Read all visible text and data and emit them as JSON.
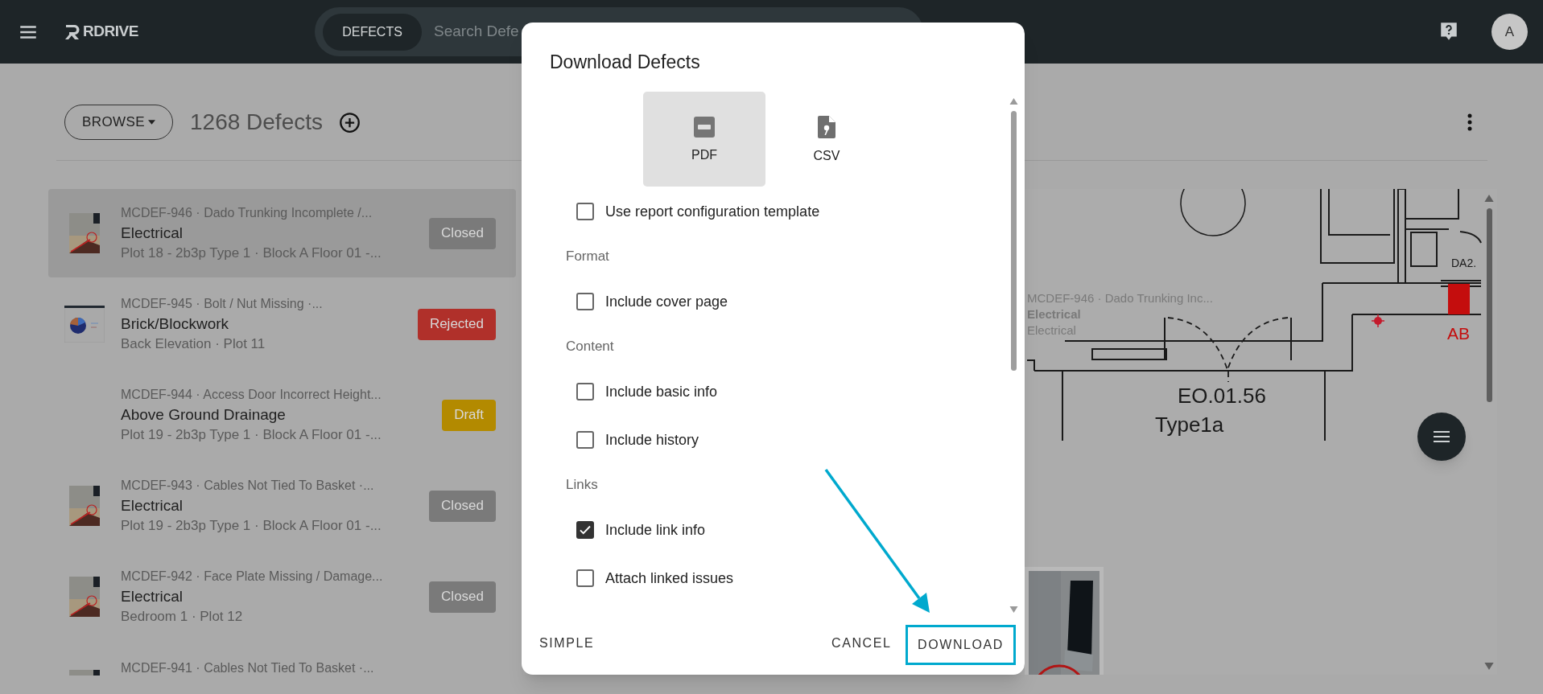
{
  "top_bar": {
    "logo": "RDRIVE",
    "search": {
      "scope": "DEFECTS",
      "placeholder": "Search Defe"
    },
    "avatar": "A"
  },
  "list_header": {
    "browse": "BROWSE",
    "count": "1268 Defects"
  },
  "defects": [
    {
      "selected": true,
      "thumbnail": true,
      "title": "MCDEF-946 · Dado Trunking Incomplete /...",
      "category": "Electrical",
      "location": "Plot 18 - 2b3p Type 1 · Block A Floor 01 -...",
      "status": "Closed",
      "color": "#7a7a7a"
    },
    {
      "selected": false,
      "thumbnail": true,
      "title": "MCDEF-945 · Bolt / Nut Missing ·...",
      "category": "Brick/Blockwork",
      "location": "Back Elevation · Plot 11",
      "status": "Rejected",
      "color": "#b0302a"
    },
    {
      "selected": false,
      "thumbnail": false,
      "title": "MCDEF-944 · Access Door Incorrect Height...",
      "category": "Above Ground Drainage",
      "location": "Plot 19 - 2b3p Type 1 · Block A Floor 01 -...",
      "status": "Draft",
      "color": "#b38a00"
    },
    {
      "selected": false,
      "thumbnail": true,
      "title": "MCDEF-943 · Cables Not Tied To Basket ·...",
      "category": "Electrical",
      "location": "Plot 19 - 2b3p Type 1 · Block A Floor 01 -...",
      "status": "Closed",
      "color": "#7a7a7a"
    },
    {
      "selected": false,
      "thumbnail": true,
      "title": "MCDEF-942 · Face Plate Missing / Damage...",
      "category": "Electrical",
      "location": "Bedroom 1 · Plot 12",
      "status": "Closed",
      "color": "#7a7a7a"
    },
    {
      "selected": false,
      "thumbnail": true,
      "title": "MCDEF-941 · Cables Not Tied To Basket ·..."
    }
  ],
  "plan": {
    "pin_label": {
      "title": "MCDEF-946 · Dado Trunking Inc...",
      "category": "Electrical",
      "subcategory": "Electrical"
    },
    "room": "EO.01.56",
    "room_type": "Type1a",
    "tag": "DA2.",
    "marker": "AB"
  },
  "dialog": {
    "title": "Download Defects",
    "formats": [
      {
        "kind": "pdf",
        "label": "PDF",
        "selected": true
      },
      {
        "kind": "csv",
        "label": "CSV",
        "selected": false
      }
    ],
    "options": [
      {
        "kind": "checkbox",
        "label": "Use report configuration template",
        "checked": false
      },
      {
        "kind": "section",
        "label": "Format"
      },
      {
        "kind": "checkbox",
        "label": "Include cover page",
        "checked": false
      },
      {
        "kind": "section",
        "label": "Content"
      },
      {
        "kind": "checkbox",
        "label": "Include basic info",
        "checked": false
      },
      {
        "kind": "checkbox",
        "label": "Include history",
        "checked": false
      },
      {
        "kind": "section",
        "label": "Links"
      },
      {
        "kind": "checkbox",
        "label": "Include link info",
        "checked": true
      },
      {
        "kind": "checkbox",
        "label": "Attach linked issues",
        "checked": false
      }
    ],
    "buttons": {
      "simple": "SIMPLE",
      "cancel": "CANCEL",
      "download": "DOWNLOAD"
    }
  }
}
